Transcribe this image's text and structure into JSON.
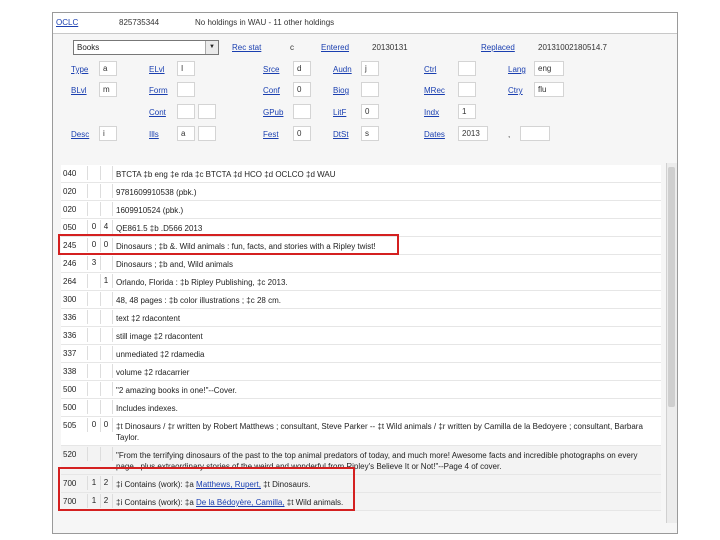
{
  "header": {
    "oclc_label": "OCLC",
    "oclc_number": "825735344",
    "holdings_text": "No holdings in WAU - 11 other holdings"
  },
  "fixed": {
    "format_select": "Books",
    "rec_stat_label": "Rec stat",
    "rec_stat_value": "c",
    "entered_label": "Entered",
    "entered_value": "20130131",
    "replaced_label": "Replaced",
    "replaced_value": "20131002180514.7",
    "type_label": "Type",
    "type_value": "a",
    "elvl_label": "ELvl",
    "elvl_value": "I",
    "srce_label": "Srce",
    "srce_value": "d",
    "audn_label": "Audn",
    "audn_value": "j",
    "ctrl_label": "Ctrl",
    "ctrl_value": "",
    "lang_label": "Lang",
    "lang_value": "eng",
    "blvl_label": "BLvl",
    "blvl_value": "m",
    "form_label": "Form",
    "form_value": "",
    "conf_label": "Conf",
    "conf_value": "0",
    "biog_label": "Biog",
    "biog_value": "",
    "mrec_label": "MRec",
    "mrec_value": "",
    "ctry_label": "Ctry",
    "ctry_value": "flu",
    "cont_label": "Cont",
    "cont_value": "",
    "gpub_label": "GPub",
    "gpub_value": "",
    "litf_label": "LitF",
    "litf_value": "0",
    "indx_label": "Indx",
    "indx_value": "1",
    "desc_label": "Desc",
    "desc_value": "i",
    "ills_label": "Ills",
    "ills_value": "a",
    "fest_label": "Fest",
    "fest_value": "0",
    "dtst_label": "DtSt",
    "dtst_value": "s",
    "dates_label": "Dates",
    "dates_value": "2013",
    "dates_sep": ","
  },
  "fields": [
    {
      "tag": "040",
      "i1": "",
      "i2": "",
      "content": "BTCTA ‡b eng ‡e rda ‡c BTCTA ‡d HCO ‡d OCLCO ‡d WAU"
    },
    {
      "tag": "020",
      "i1": "",
      "i2": "",
      "content": "9781609910538 (pbk.)"
    },
    {
      "tag": "020",
      "i1": "",
      "i2": "",
      "content": "1609910524 (pbk.)"
    },
    {
      "tag": "050",
      "i1": "0",
      "i2": "4",
      "content": "QE861.5 ‡b .D566 2013"
    },
    {
      "tag": "245",
      "i1": "0",
      "i2": "0",
      "content": "Dinosaurs ; ‡b &. Wild animals : fun, facts, and stories with a Ripley twist!"
    },
    {
      "tag": "246",
      "i1": "3",
      "i2": "",
      "content": "Dinosaurs ; ‡b and, Wild animals"
    },
    {
      "tag": "264",
      "i1": "",
      "i2": "1",
      "content": "Orlando, Florida : ‡b Ripley Publishing, ‡c 2013."
    },
    {
      "tag": "300",
      "i1": "",
      "i2": "",
      "content": "48, 48 pages : ‡b color illustrations ; ‡c 28 cm."
    },
    {
      "tag": "336",
      "i1": "",
      "i2": "",
      "content": "text ‡2 rdacontent"
    },
    {
      "tag": "336",
      "i1": "",
      "i2": "",
      "content": "still image ‡2 rdacontent"
    },
    {
      "tag": "337",
      "i1": "",
      "i2": "",
      "content": "unmediated ‡2 rdamedia"
    },
    {
      "tag": "338",
      "i1": "",
      "i2": "",
      "content": "volume ‡2 rdacarrier"
    },
    {
      "tag": "500",
      "i1": "",
      "i2": "",
      "content": "\"2 amazing books in one!\"--Cover."
    },
    {
      "tag": "500",
      "i1": "",
      "i2": "",
      "content": "Includes indexes."
    },
    {
      "tag": "505",
      "i1": "0",
      "i2": "0",
      "content": "‡t Dinosaurs / ‡r written by Robert Matthews ; consultant, Steve Parker -- ‡t Wild animals / ‡r written by Camilla de la Bedoyere ; consultant, Barbara Taylor."
    },
    {
      "tag": "520",
      "i1": "",
      "i2": "",
      "content": "\"From the terrifying dinosaurs of the past to the top animal predators of today, and much more! Awesome facts and incredible photographs on every page...plus extraordinary stories of the weird and wonderful from Ripley's Believe It or Not!\"--Page 4 of cover."
    },
    {
      "tag": "700",
      "i1": "1",
      "i2": "2",
      "content_pre": "‡i Contains (work): ‡a ",
      "link": "Matthews, Rupert,",
      "content_post": " ‡t Dinosaurs."
    },
    {
      "tag": "700",
      "i1": "1",
      "i2": "2",
      "content_pre": "‡i Contains (work): ‡a ",
      "link": "De la Bédoyère, Camilla,",
      "content_post": " ‡t Wild animals."
    }
  ],
  "colors": {
    "link": "#1a3fb0",
    "highlight": "#d42020"
  }
}
